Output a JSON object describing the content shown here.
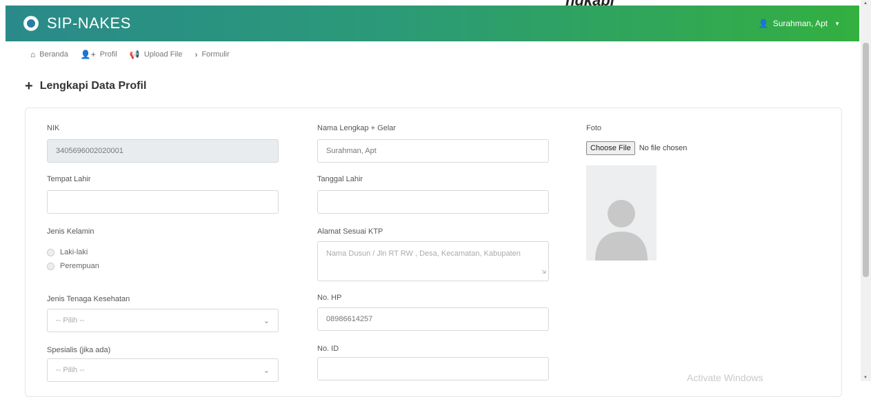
{
  "navbar": {
    "brand": "SIP-NAKES",
    "user_name": "Surahman, Apt",
    "brand_color": "#2b9a78",
    "icons": {
      "logo": "sip-nakes-logo",
      "user": "user-icon",
      "caret": "caret-down-icon"
    }
  },
  "breadcrumb": [
    {
      "label": "Beranda",
      "icon": "home-icon"
    },
    {
      "label": "Profil",
      "icon": "user-plus-icon"
    },
    {
      "label": "Upload File",
      "icon": "megaphone-icon"
    },
    {
      "label": "Formulir",
      "icon": "chevron-right-icon"
    }
  ],
  "page_title": "Lengkapi Data Profil",
  "form": {
    "nik": {
      "label": "NIK",
      "value": "3405696002020001"
    },
    "tempat_lahir": {
      "label": "Tempat Lahir",
      "value": ""
    },
    "jenis_kelamin": {
      "label": "Jenis Kelamin",
      "options": [
        "Laki-laki",
        "Perempuan"
      ]
    },
    "jenis_tenaga": {
      "label": "Jenis Tenaga Kesehatan",
      "value": "-- Pilih --"
    },
    "spesialis": {
      "label": "Spesialis (jika ada)",
      "value": "-- Pilih --"
    },
    "nama": {
      "label": "Nama Lengkap + Gelar",
      "value": "Surahman, Apt"
    },
    "tanggal_lahir": {
      "label": "Tanggal Lahir",
      "value": ""
    },
    "alamat": {
      "label": "Alamat Sesuai KTP",
      "placeholder": "Nama Dusun / Jln RT  RW , Desa, Kecamatan, Kabupaten"
    },
    "no_hp": {
      "label": "No. HP",
      "value": "08986614257"
    },
    "no_id": {
      "label": "No. ID",
      "value": ""
    },
    "foto": {
      "label": "Foto",
      "button": "Choose File",
      "status": "No file chosen"
    }
  },
  "watermark": "Activate Windows",
  "header_cutoff": "ngkapi"
}
